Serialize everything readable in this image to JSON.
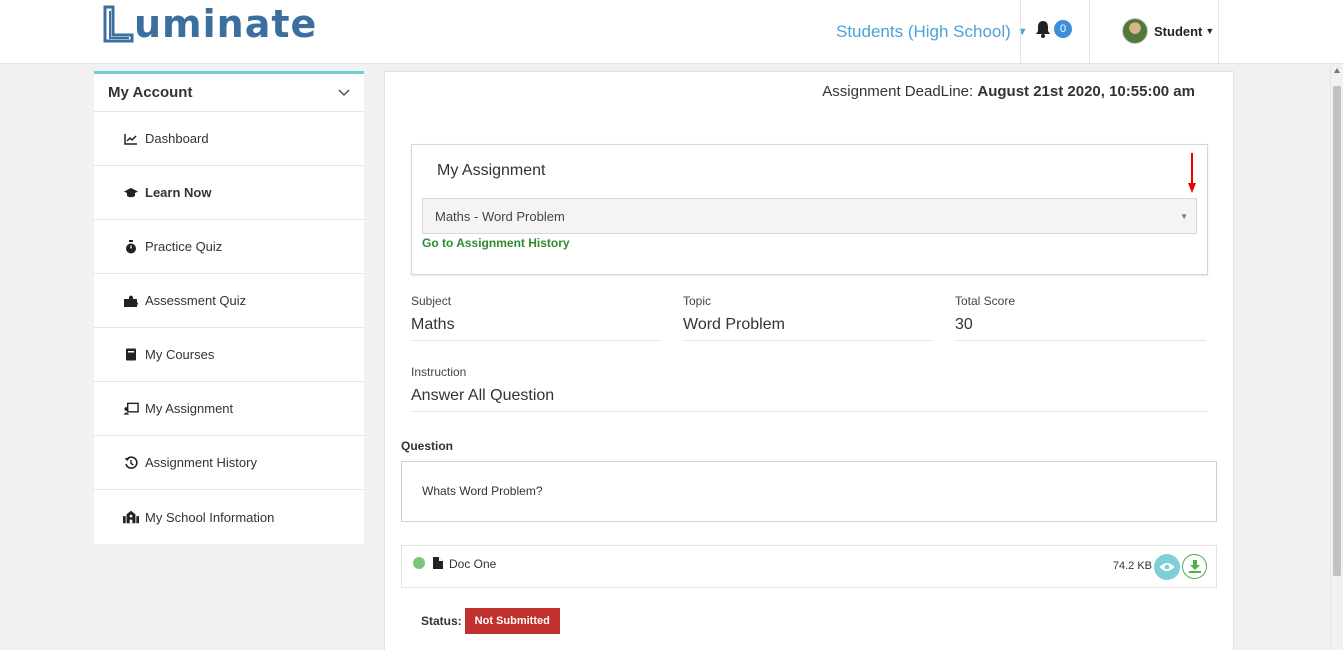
{
  "header": {
    "logo_text": "uminate",
    "role_label": "Students (High School)",
    "notification_count": "0",
    "user_label": "Student"
  },
  "sidebar": {
    "title": "My Account",
    "items": [
      {
        "label": "Dashboard",
        "icon": "chart-line-icon"
      },
      {
        "label": "Learn Now",
        "icon": "graduation-cap-icon"
      },
      {
        "label": "Practice Quiz",
        "icon": "stopwatch-icon"
      },
      {
        "label": "Assessment Quiz",
        "icon": "puzzle-icon"
      },
      {
        "label": "My Courses",
        "icon": "book-icon"
      },
      {
        "label": "My Assignment",
        "icon": "chalkboard-teacher-icon"
      },
      {
        "label": "Assignment History",
        "icon": "history-icon"
      },
      {
        "label": "My School Information",
        "icon": "school-icon"
      }
    ]
  },
  "main": {
    "deadline_label": "Assignment DeadLine:",
    "deadline_value": "August 21st 2020, 10:55:00 am",
    "assignment_title": "My Assignment",
    "assignment_selected": "Maths - Word Problem",
    "history_link": "Go to Assignment History",
    "subject_label": "Subject",
    "subject_value": "Maths",
    "topic_label": "Topic",
    "topic_value": "Word Problem",
    "score_label": "Total Score",
    "score_value": "30",
    "instruction_label": "Instruction",
    "instruction_value": "Answer All Question",
    "question_label": "Question",
    "question_text": "Whats Word Problem?",
    "doc_name": "Doc One",
    "doc_size": "74.2 KB",
    "status_label": "Status:",
    "status_value": "Not Submitted"
  },
  "colors": {
    "accent_teal": "#70cfd4",
    "link_blue": "#4aa3d6",
    "brand_blue": "#3b6fa0",
    "success_green": "#2e8b2e",
    "danger_red": "#c0312d"
  }
}
